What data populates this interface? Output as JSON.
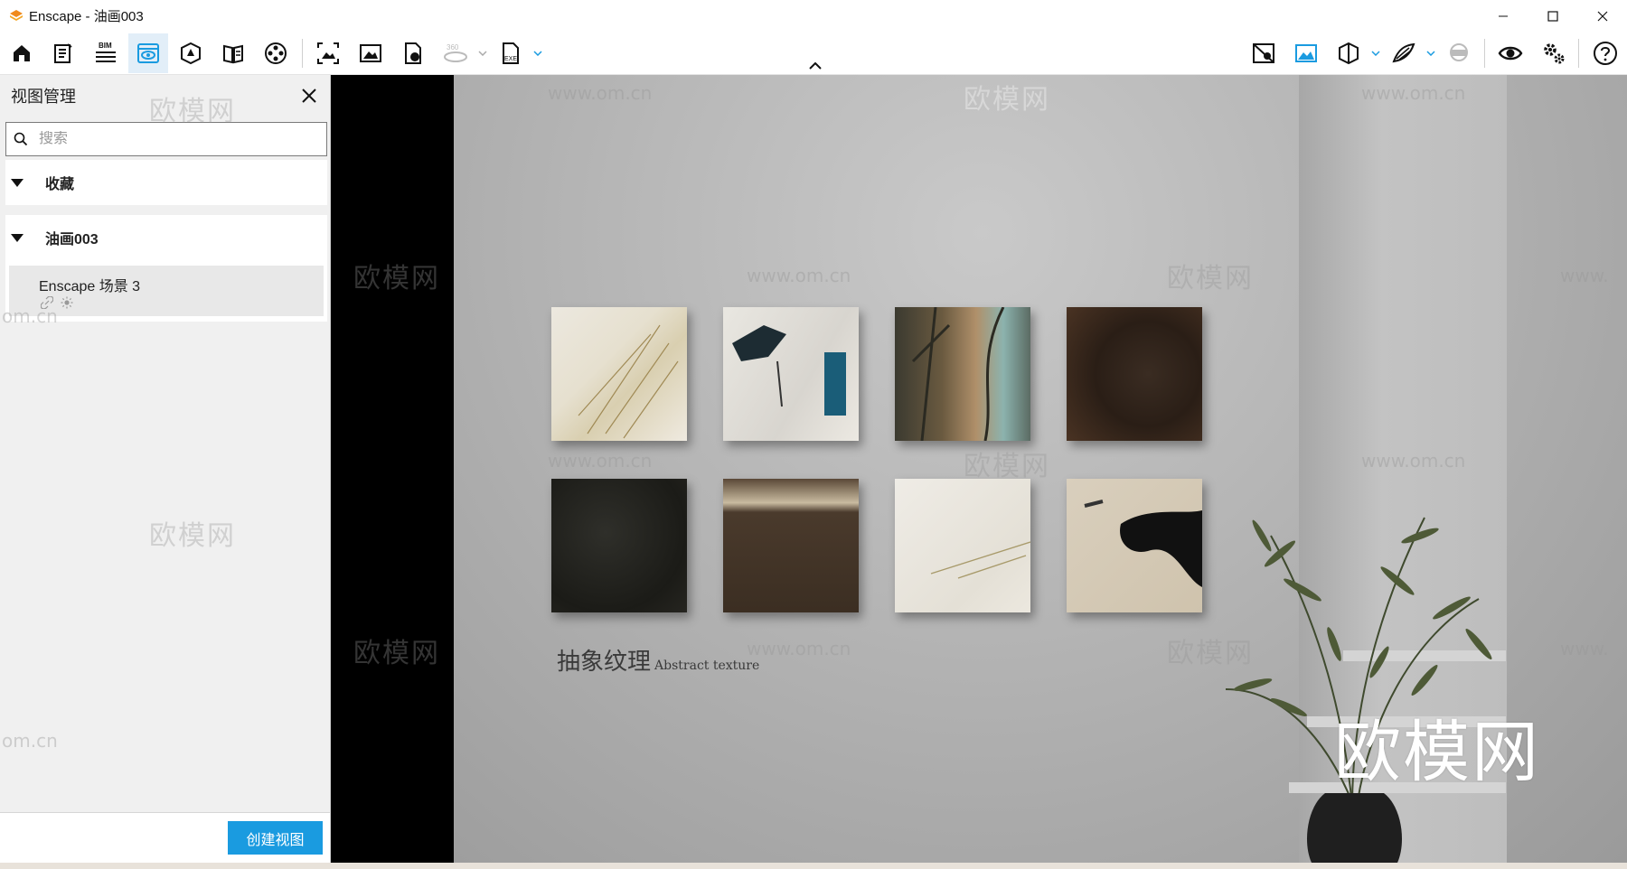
{
  "window": {
    "title": "Enscape - 油画003"
  },
  "toolbar": {
    "bim_label": "BIM",
    "pano_label": "360",
    "exe_label": "EXE"
  },
  "sidebar": {
    "title": "视图管理",
    "search_placeholder": "搜索",
    "favorites_label": "收藏",
    "group_label": "油画003",
    "views": [
      {
        "name": "Enscape 场景 3"
      }
    ],
    "create_button": "创建视图"
  },
  "scene": {
    "title_cn": "抽象纹理",
    "title_en": "Abstract texture",
    "watermark_large": "欧模网",
    "watermark_text": "欧模网",
    "watermark_url": "www.om.cn",
    "watermark_url_fragment": "om.cn",
    "watermark_url_fragment_right": "www."
  },
  "colors": {
    "accent": "#1a9be0",
    "active_tool_bg": "#e2eef8",
    "logo": "#f08a1c"
  }
}
